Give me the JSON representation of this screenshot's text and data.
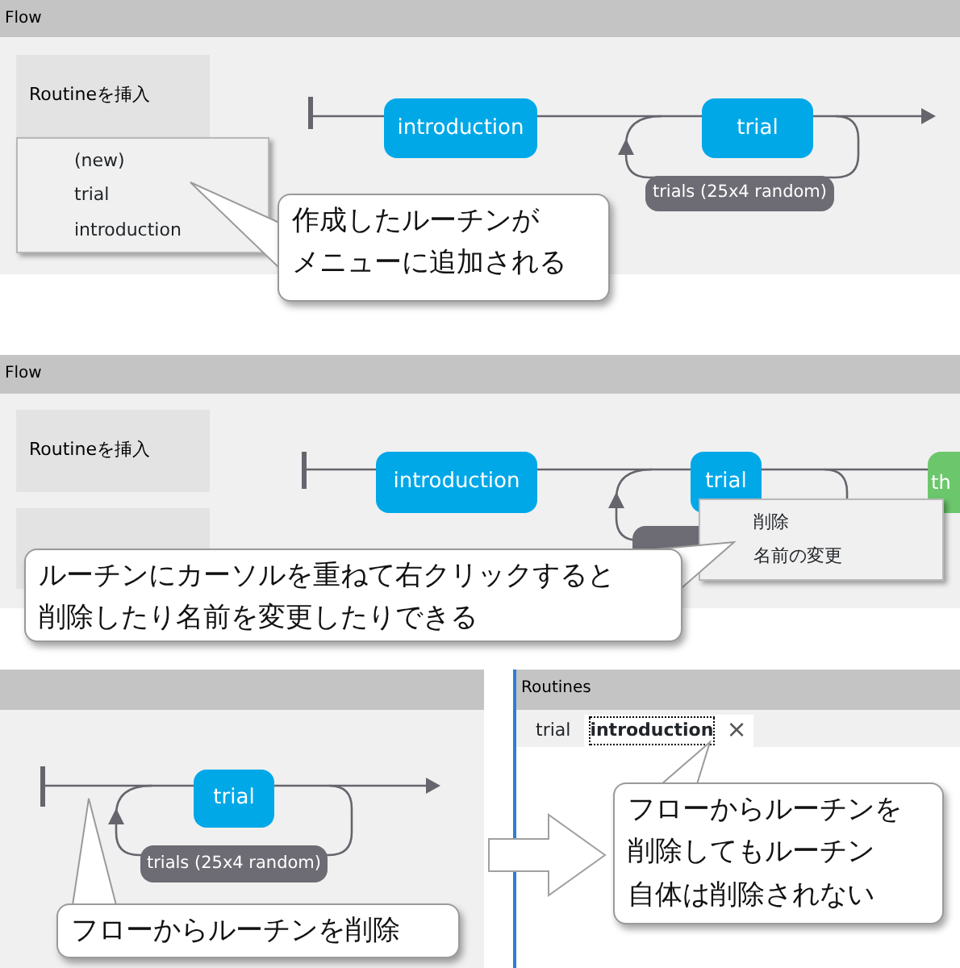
{
  "sections": [
    {
      "header": "Flow",
      "insert_buttons": [
        "Routineを挿入"
      ],
      "nodes": [
        {
          "label": "introduction",
          "color": "#00a8e8"
        },
        {
          "label": "trial",
          "color": "#00a8e8"
        }
      ],
      "loop_label": "trials  (25x4 random)",
      "menu_items": [
        "(new)",
        "trial",
        "introduction"
      ],
      "callout": [
        "作成したルーチンが",
        "メニューに追加される"
      ]
    },
    {
      "header": "Flow",
      "insert_buttons": [
        "Routineを挿入"
      ],
      "nodes": [
        {
          "label": "introduction",
          "color": "#00a8e8"
        },
        {
          "label": "trial",
          "color": "#00a8e8"
        },
        {
          "label": "th",
          "color": "#6cc76c"
        }
      ],
      "menu_items": [
        "削除",
        "名前の変更"
      ],
      "callout": [
        "ルーチンにカーソルを重ねて右クリックすると",
        "削除したり名前を変更したりできる"
      ]
    },
    {
      "nodes": [
        {
          "label": "trial",
          "color": "#00a8e8"
        }
      ],
      "loop_label": "trials  (25x4 random)",
      "callout": [
        "フローからルーチンを削除"
      ]
    }
  ],
  "routines": {
    "header": "Routines",
    "tabs": [
      {
        "label": "trial",
        "selected": false,
        "closable": false
      },
      {
        "label": "introduction",
        "selected": true,
        "closable": true
      }
    ],
    "close_glyph": "×",
    "callout": [
      "フローからルーチンを",
      "削除してもルーチン",
      "自体は削除されない"
    ]
  }
}
